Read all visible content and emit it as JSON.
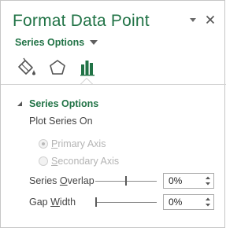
{
  "pane": {
    "title": "Format Data Point",
    "options_menu_label": "Series Options",
    "tabs": [
      {
        "name": "Fill & Line",
        "icon": "paint-bucket-icon"
      },
      {
        "name": "Effects",
        "icon": "pentagon-icon"
      },
      {
        "name": "Series Options",
        "icon": "bar-chart-icon",
        "selected": true
      }
    ]
  },
  "section": {
    "title": "Series Options",
    "plot_series_on": "Plot Series On",
    "primary_axis": {
      "pre": "",
      "underline": "P",
      "post": "rimary Axis",
      "selected": true,
      "enabled": false
    },
    "secondary_axis": {
      "pre": "",
      "underline": "S",
      "post": "econdary Axis",
      "selected": false,
      "enabled": false
    },
    "series_overlap": {
      "pre": "Series ",
      "underline": "O",
      "post": "verlap",
      "value": "0%",
      "level_percent": 0
    },
    "gap_width": {
      "pre": "Gap ",
      "underline": "W",
      "post": "idth",
      "value": "0%",
      "level_percent": 0
    }
  },
  "colors": {
    "accent": "#217346",
    "text": "#444444",
    "disabled": "#b4b4b4"
  }
}
